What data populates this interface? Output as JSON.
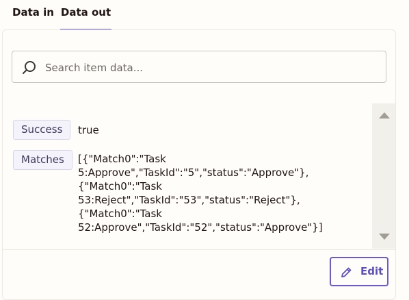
{
  "tabs": [
    {
      "label": "Data in",
      "active": false
    },
    {
      "label": "Data out",
      "active": true
    }
  ],
  "search": {
    "placeholder": "Search item data...",
    "value": "",
    "icon": "search-icon"
  },
  "fields": [
    {
      "key": "Success",
      "value": "true"
    },
    {
      "key": "Matches",
      "value": "[{\"Match0\":\"Task\n5:Approve\",\"TaskId\":\"5\",\"status\":\"Approve\"},\n{\"Match0\":\"Task\n53:Reject\",\"TaskId\":\"53\",\"status\":\"Reject\"},\n{\"Match0\":\"Task\n52:Approve\",\"TaskId\":\"52\",\"status\":\"Approve\"}]"
    }
  ],
  "actions": {
    "edit_label": "Edit",
    "edit_icon": "pencil-icon"
  },
  "colors": {
    "accent": "#6a5acd",
    "chip_background": "#f4f2fb",
    "background": "#fffdf9"
  }
}
